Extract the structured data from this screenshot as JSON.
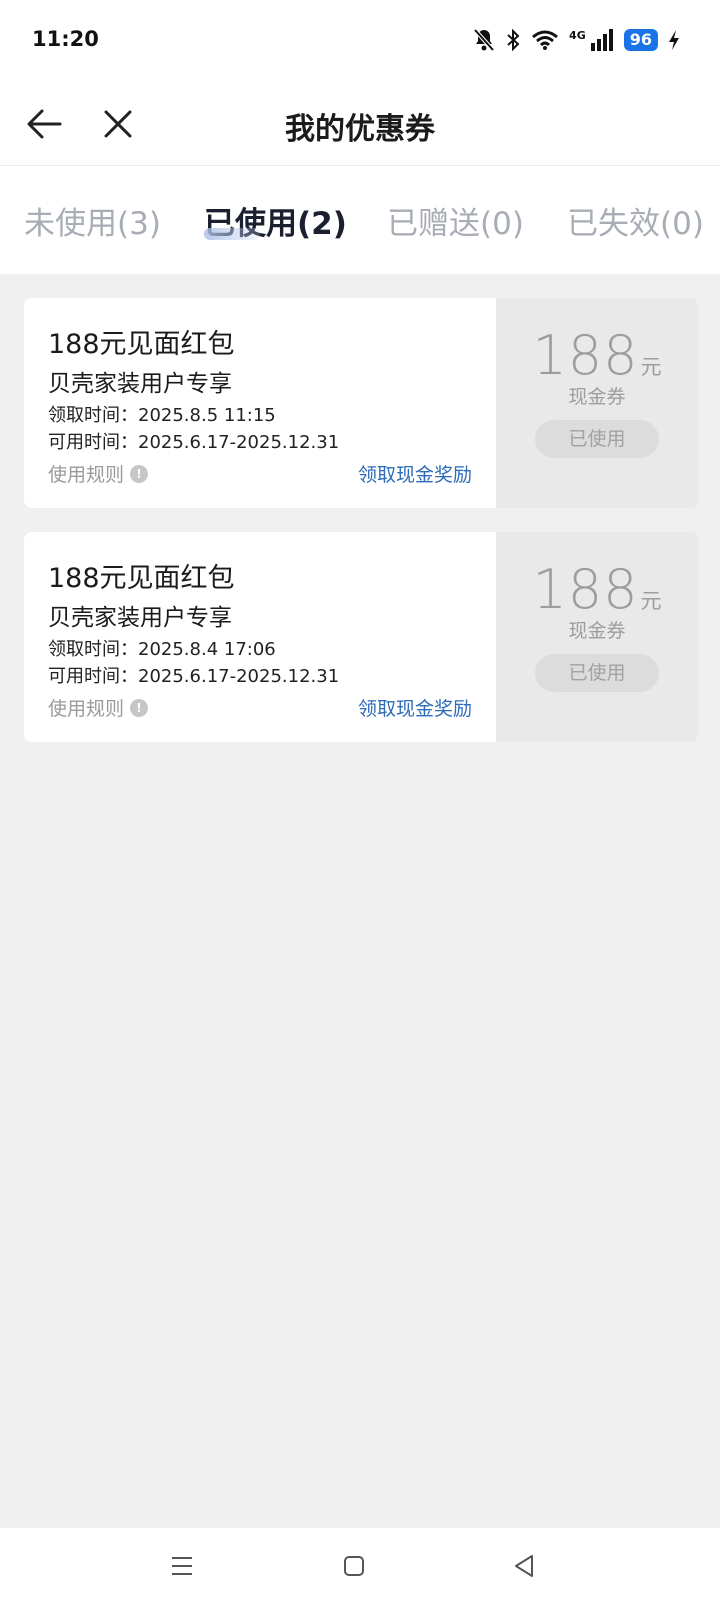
{
  "status_bar": {
    "time": "11:20",
    "network": "4G",
    "battery": "96",
    "icons": [
      "bell-off-icon",
      "bluetooth-icon",
      "wifi-icon",
      "signal-icon",
      "charging-icon"
    ]
  },
  "navbar": {
    "title": "我的优惠券",
    "icons": [
      "back-arrow-icon",
      "close-icon"
    ]
  },
  "tabs": [
    {
      "label": "未使用(3)",
      "active": false
    },
    {
      "label": "已使用(2)",
      "active": true
    },
    {
      "label": "已赠送(0)",
      "active": false
    },
    {
      "label": "已失效(0)",
      "active": false
    }
  ],
  "coupons": [
    {
      "name": "188元见面红包",
      "subtitle": "贝壳家装用户专享",
      "received": "领取时间：2025.8.5 11:15",
      "valid": "可用时间：2025.6.17-2025.12.31",
      "rules": "使用规则",
      "link": "领取现金奖励",
      "amount": "188",
      "unit": "元",
      "type": "现金券",
      "status": "已使用"
    },
    {
      "name": "188元见面红包",
      "subtitle": "贝壳家装用户专享",
      "received": "领取时间：2025.8.4 17:06",
      "valid": "可用时间：2025.6.17-2025.12.31",
      "rules": "使用规则",
      "link": "领取现金奖励",
      "amount": "188",
      "unit": "元",
      "type": "现金券",
      "status": "已使用"
    }
  ],
  "colors": {
    "accent_link": "#2e6bb8",
    "battery": "#1a73e8",
    "page_bg": "#f0f0f0"
  },
  "system_nav": [
    "menu-icon",
    "home-icon",
    "back-icon"
  ]
}
